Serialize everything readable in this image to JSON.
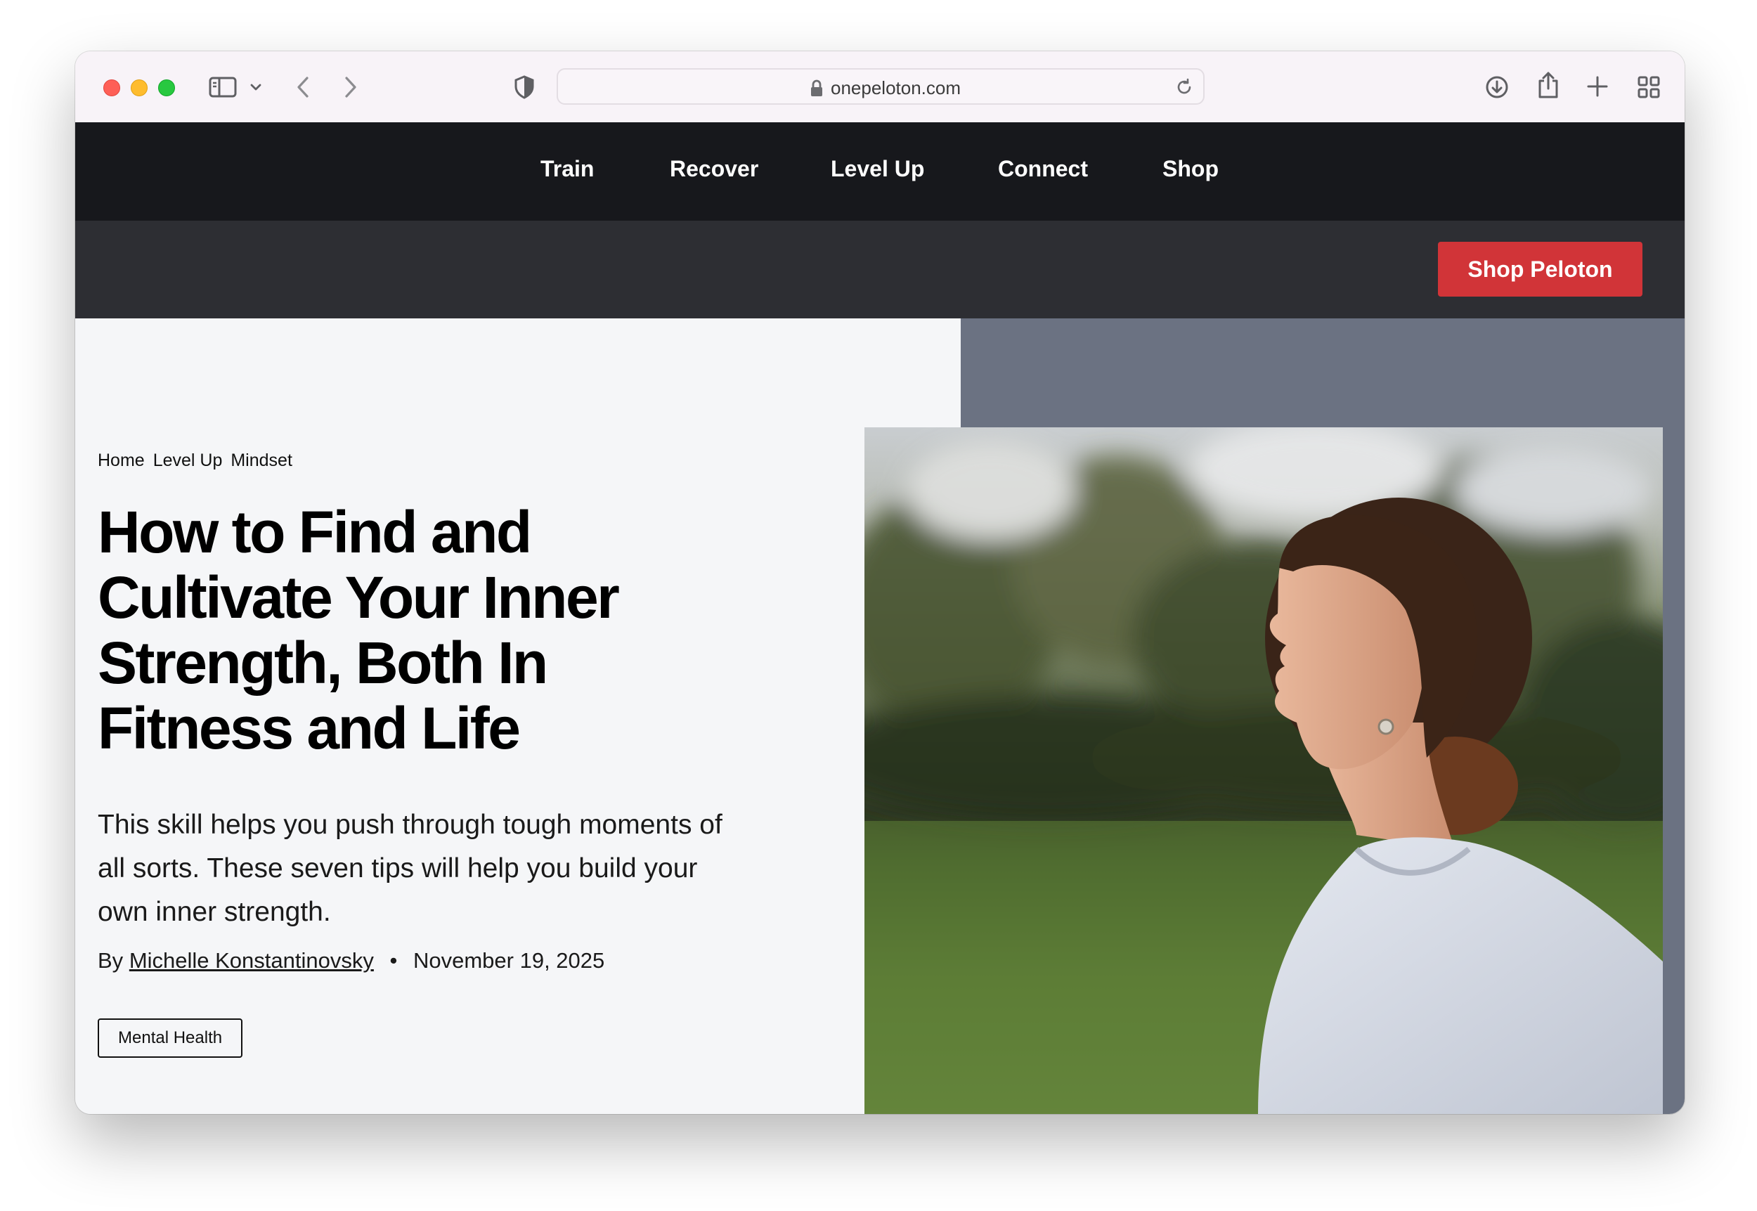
{
  "browser": {
    "url": "onepeloton.com"
  },
  "nav": {
    "items": [
      "Train",
      "Recover",
      "Level Up",
      "Connect",
      "Shop"
    ]
  },
  "subbar": {
    "cta_label": "Shop Peloton",
    "cta_color": "#d13438"
  },
  "article": {
    "breadcrumb": [
      "Home",
      "Level Up",
      "Mindset"
    ],
    "title": "How to Find and Cultivate Your Inner Strength, Both In Fitness and Life",
    "dek": "This skill helps you push through tough moments of all sorts. These seven tips will help you build your own inner strength.",
    "byline_prefix": "By",
    "author": "Michelle Konstantinovsky",
    "separator": "•",
    "date": "November 19, 2025",
    "tag": "Mental Health"
  },
  "colors": {
    "nav_bg": "#17181c",
    "subbar_bg": "#2d2e33",
    "hero_bg": "#f5f6f8",
    "hero_panel_bg": "#6b7282"
  },
  "icons": [
    "sidebar-icon",
    "chevron-down-icon",
    "back-icon",
    "forward-icon",
    "shield-icon",
    "lock-icon",
    "reload-icon",
    "download-icon",
    "share-icon",
    "plus-icon",
    "tab-overview-icon"
  ]
}
